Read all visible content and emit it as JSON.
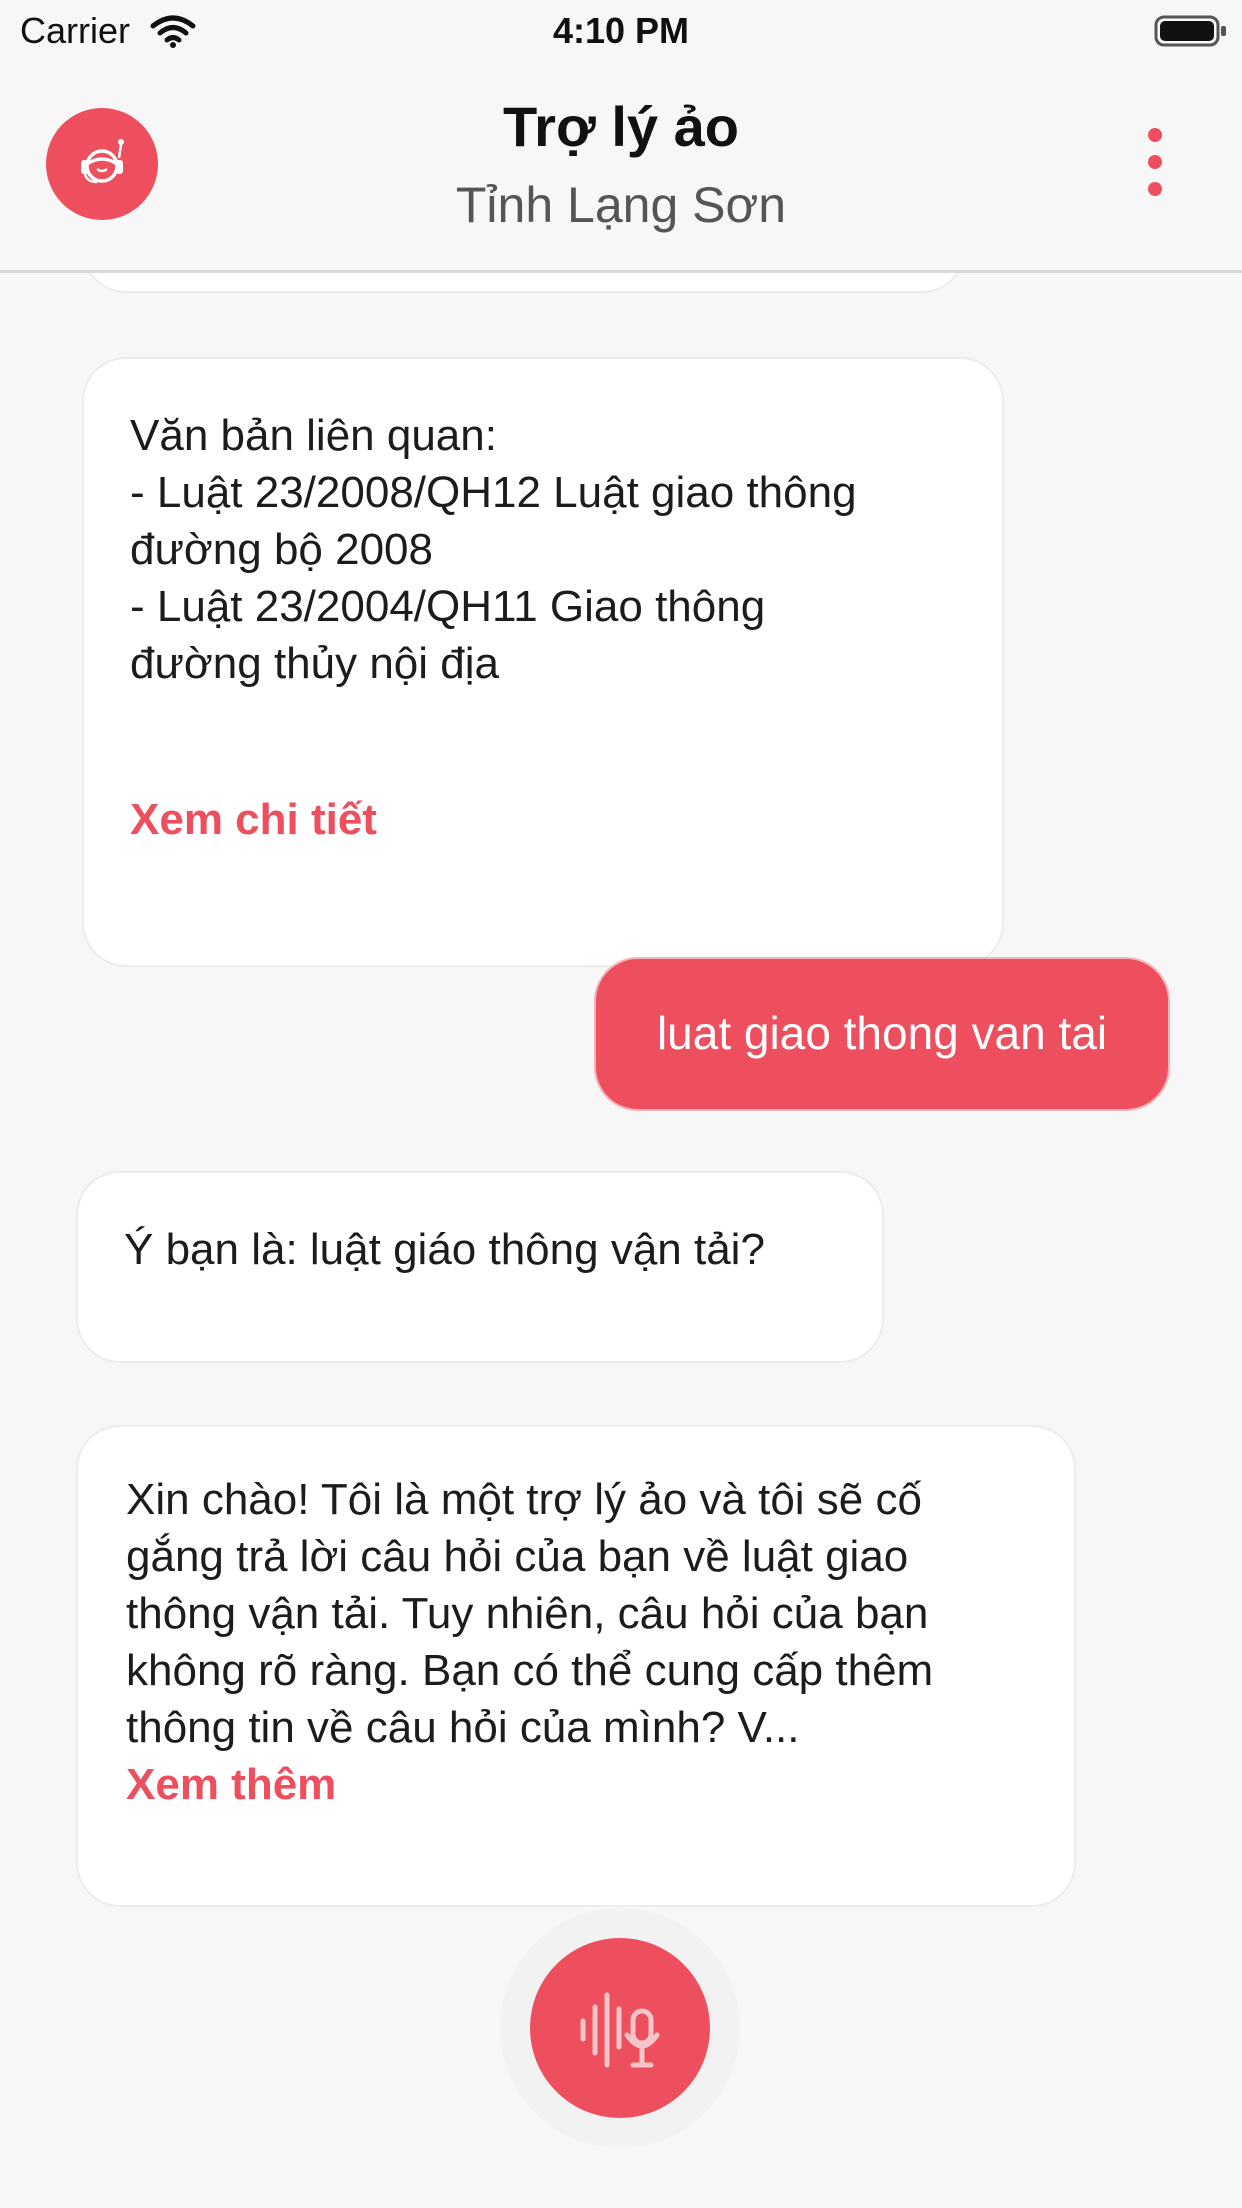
{
  "status_bar": {
    "carrier": "Carrier",
    "time": "4:10 PM"
  },
  "header": {
    "title": "Trợ lý ảo",
    "subtitle": "Tỉnh Lạng Sơn",
    "avatar_icon": "assistant-headset-icon",
    "menu_icon": "more-vertical-icon"
  },
  "messages": {
    "docs": {
      "lines": [
        "Văn bản liên quan:",
        "- Luật 23/2008/QH12 Luật giao thông",
        "đường bộ 2008",
        "- Luật 23/2004/QH11 Giao thông",
        "đường thủy nội địa"
      ],
      "link": "Xem chi tiết"
    },
    "user": {
      "text": "luat giao thong van tai"
    },
    "suggest": {
      "text": "Ý bạn là: luật giáo thông vận tải?"
    },
    "answer": {
      "lines": [
        "Xin chào! Tôi là một trợ lý ảo và tôi sẽ cố",
        "gắng trả lời câu hỏi của bạn về luật giao",
        "thông vận tải. Tuy nhiên, câu hỏi của bạn",
        "không rõ ràng. Bạn có thể cung cấp thêm",
        "thông tin về câu hỏi của mình? V..."
      ],
      "link": "Xem thêm"
    }
  },
  "mic": {
    "icon": "voice-microphone-icon"
  },
  "colors": {
    "accent": "#ee4f5e",
    "background": "#f7f7f7",
    "bubble": "#ffffff"
  }
}
